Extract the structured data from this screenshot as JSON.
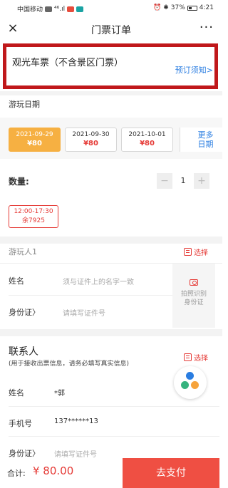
{
  "status_bar": {
    "carrier": "中国移动",
    "signal": "⁴⁶.ıl",
    "battery": "37%",
    "time": "4:21"
  },
  "header": {
    "title": "门票订单",
    "close_icon": "×",
    "more_icon": "···"
  },
  "ticket": {
    "name": "观光车票（不含景区门票）",
    "booking_notice": "预订须知>"
  },
  "travel_date": {
    "label": "游玩日期",
    "dates": [
      {
        "date": "2021-09-29",
        "price": "¥80",
        "selected": true
      },
      {
        "date": "2021-09-30",
        "price": "¥80",
        "selected": false
      },
      {
        "date": "2021-10-01",
        "price": "¥80",
        "selected": false
      }
    ],
    "more_line1": "更多",
    "more_line2": "日期"
  },
  "quantity": {
    "label": "数量:",
    "minus": "−",
    "value": "1",
    "plus": "+"
  },
  "time_slot": {
    "time": "12:00-17:30",
    "remaining": "余7925"
  },
  "visitor": {
    "label": "游玩人1",
    "select_label": "选择",
    "name_label": "姓名",
    "name_placeholder": "须与证件上的名字一致",
    "id_label": "身份证〉",
    "id_placeholder": "请填写证件号",
    "scan_line1": "拍照识别",
    "scan_line2": "身份证"
  },
  "contact": {
    "title": "联系人",
    "note": "(用于接收出票信息，请务必填写真实信息)",
    "select_label": "选择",
    "name_label": "姓名",
    "name_value": "*郭",
    "phone_label": "手机号",
    "phone_value": "137******13",
    "id_label": "身份证〉",
    "id_placeholder": "请填写证件号"
  },
  "footer": {
    "total_label": "合计:",
    "total_amount": "¥ 80.00",
    "pay_label": "去支付"
  },
  "colors": {
    "accent_red": "#e53935",
    "highlight_border": "#c0181b",
    "selected_date": "#f6b042",
    "link_blue": "#2a7de1",
    "pay_button": "#ef4f43"
  }
}
